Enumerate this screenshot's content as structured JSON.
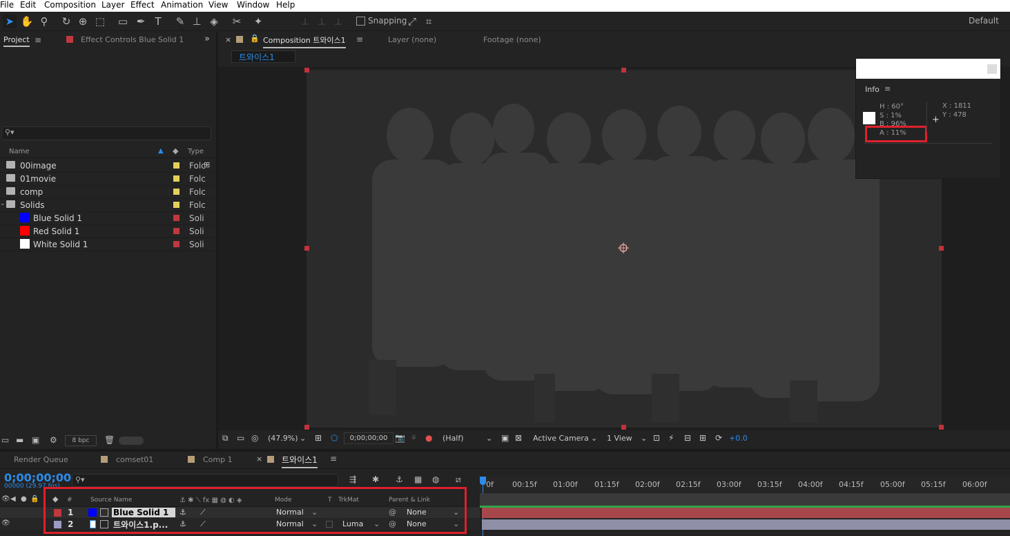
{
  "menu": [
    "File",
    "Edit",
    "Composition",
    "Layer",
    "Effect",
    "Animation",
    "View",
    "Window",
    "Help"
  ],
  "toolbar": {
    "snapping_label": "Snapping",
    "workspace": "Default"
  },
  "project_panel": {
    "tab_project": "Project",
    "tab_effect_controls": "Effect Controls Blue Solid 1",
    "col_name": "Name",
    "col_type": "Type",
    "items": [
      {
        "name": "00image",
        "type": "Folc",
        "kind": "folder",
        "tag": "#e3d05a"
      },
      {
        "name": "01movie",
        "type": "Folc",
        "kind": "folder",
        "tag": "#e3d05a"
      },
      {
        "name": "comp",
        "type": "Folc",
        "kind": "folder",
        "tag": "#e3d05a"
      },
      {
        "name": "Solids",
        "type": "Folc",
        "kind": "folder",
        "tag": "#e3d05a"
      },
      {
        "name": "Blue Solid 1",
        "type": "Soli",
        "kind": "solid",
        "swatch": "#0000ff",
        "tag": "#c0383f"
      },
      {
        "name": "Red Solid 1",
        "type": "Soli",
        "kind": "solid",
        "swatch": "#ff0000",
        "tag": "#c0383f"
      },
      {
        "name": "White Solid 1",
        "type": "Soli",
        "kind": "solid",
        "swatch": "#ffffff",
        "tag": "#c0383f"
      }
    ],
    "bpc": "8 bpc"
  },
  "viewer": {
    "tab_composition": "Composition 트와이스1",
    "tab_layer": "Layer (none)",
    "tab_footage": "Footage (none)",
    "crumb": "트와이스1",
    "zoom": "(47.9%)",
    "timecode": "0;00;00;00",
    "resolution": "(Half)",
    "camera": "Active Camera",
    "views": "1 View",
    "exposure": "+0.0"
  },
  "info_panel": {
    "title": "Info",
    "h": "H : 60°",
    "s": "S : 1%",
    "b": "B : 96%",
    "a": "A : 11%",
    "x": "X : 1811",
    "y": "Y : 478"
  },
  "timeline": {
    "tabs": [
      "Render Queue",
      "comset01",
      "Comp 1",
      "트와이스1"
    ],
    "timecode": "0;00;00;00",
    "fps": "00000 (29.97 fps)",
    "headers": {
      "num": "#",
      "source": "Source Name",
      "mode": "Mode",
      "t": "T",
      "trkmat": "TrkMat",
      "parent": "Parent & Link"
    },
    "ruler": [
      "0f",
      "00:15f",
      "01:00f",
      "01:15f",
      "02:00f",
      "02:15f",
      "03:00f",
      "03:15f",
      "04:00f",
      "04:15f",
      "05:00f",
      "05:15f",
      "06:00f"
    ],
    "layers": [
      {
        "num": "1",
        "name": "Blue Solid 1",
        "mode": "Normal",
        "trkmat": "",
        "parent": "None",
        "label": "#c0383f",
        "swatch": "#0000ff"
      },
      {
        "num": "2",
        "name": "트와이스1.p...",
        "mode": "Normal",
        "trkmat": "Luma",
        "parent": "None",
        "label": "#9b9bc4",
        "swatch": "#ffffff"
      }
    ]
  },
  "colors": {
    "accent": "#2d8ceb",
    "highlight": "#e0202a",
    "solid_red": "#c0383f"
  }
}
